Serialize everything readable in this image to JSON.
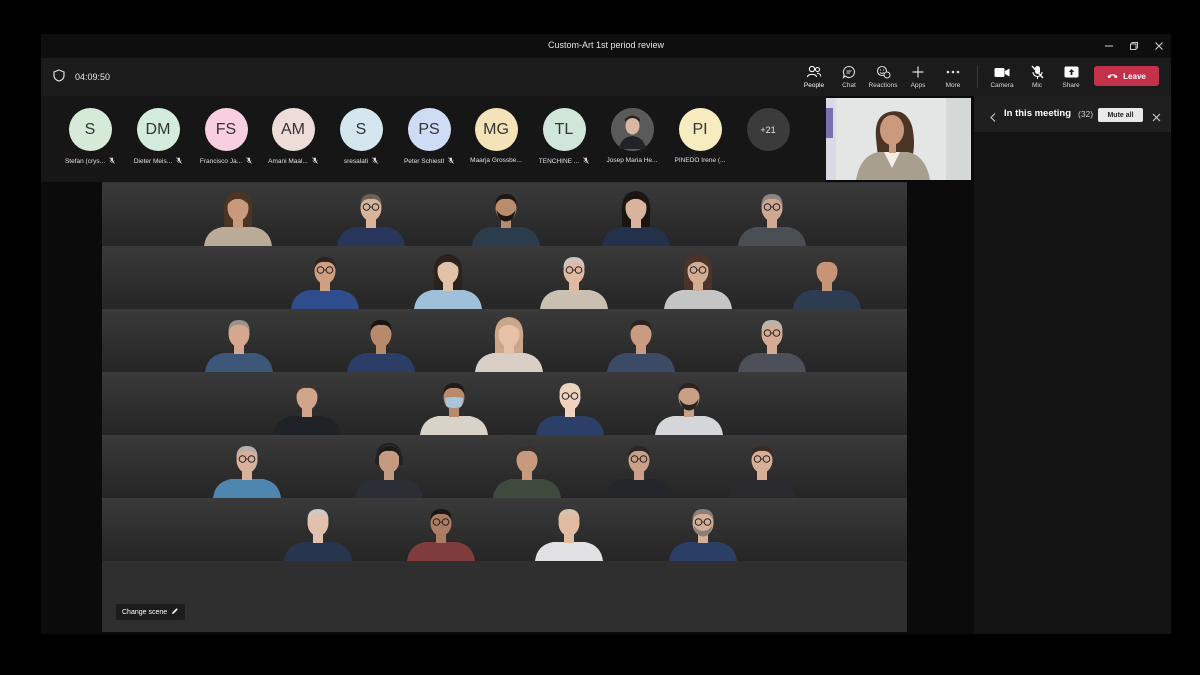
{
  "window": {
    "title": "Custom-Art 1st period review",
    "controls": [
      "minimize",
      "restore",
      "close"
    ]
  },
  "toolbar": {
    "timer": "04:09:50",
    "buttons": [
      {
        "label": "People",
        "icon": "people-icon",
        "active": true
      },
      {
        "label": "Chat",
        "icon": "chat-icon",
        "active": false
      },
      {
        "label": "Reactions",
        "icon": "reactions-icon",
        "active": false
      },
      {
        "label": "Apps",
        "icon": "apps-icon",
        "active": false
      },
      {
        "label": "More",
        "icon": "more-icon",
        "active": false
      },
      {
        "label": "Camera",
        "icon": "camera-icon",
        "active": false
      },
      {
        "label": "Mic",
        "icon": "mic-muted-icon",
        "active": false
      },
      {
        "label": "Share",
        "icon": "share-icon",
        "active": false
      }
    ],
    "leave_label": "Leave",
    "leave_color": "#c4314b"
  },
  "participants": [
    {
      "initials": "S",
      "name": "Stefan (crys...",
      "color": "#d6ead8",
      "muted": true
    },
    {
      "initials": "DM",
      "name": "Dieter Meis...",
      "color": "#d3ecdb",
      "muted": true
    },
    {
      "initials": "FS",
      "name": "Francisco Ja...",
      "color": "#f7cfe0",
      "muted": true
    },
    {
      "initials": "AM",
      "name": "Amani Maal...",
      "color": "#eddcd8",
      "muted": true
    },
    {
      "initials": "S",
      "name": "sresalati",
      "color": "#d4e7ef",
      "muted": true
    },
    {
      "initials": "PS",
      "name": "Peter Schiestl",
      "color": "#cfdcf5",
      "muted": true
    },
    {
      "initials": "MG",
      "name": "Maarja Grossbe...",
      "color": "#f4e3b8",
      "muted": false
    },
    {
      "initials": "TL",
      "name": "TENCHINE ...",
      "color": "#cfe6d8",
      "muted": true
    },
    {
      "initials": "",
      "name": "Josep Maria He...",
      "color": "#4a4a4a",
      "muted": false,
      "photo": true
    },
    {
      "initials": "PI",
      "name": "PINEDO Irene (...",
      "color": "#f6ecc0",
      "muted": false
    }
  ],
  "overflow_count": "+21",
  "panel": {
    "title": "In this meeting",
    "count": "(32)",
    "mute_all_label": "Mute all"
  },
  "change_scene_label": "Change scene",
  "together_mode": {
    "rows": [
      {
        "people": [
          {
            "skin": "#c9997c",
            "hair": "#4a3424",
            "shirt": "#b9ab95",
            "long_hair": true
          },
          {
            "skin": "#d8b49a",
            "hair": "#6c6257",
            "shirt": "#27365a",
            "glasses": true
          },
          {
            "skin": "#b98c6c",
            "hair": "#1d1715",
            "shirt": "#2b3d4d",
            "beard": true
          },
          {
            "skin": "#d9b39c",
            "hair": "#1a1412",
            "shirt": "#23324a",
            "long_hair": true
          },
          {
            "skin": "#cfa792",
            "hair": "#8b8683",
            "shirt": "#4a4f55",
            "glasses": true
          }
        ]
      },
      {
        "people": [
          {
            "skin": "#cf9f82",
            "hair": "#2b2320",
            "shirt": "#2f4c8c",
            "glasses": true
          },
          {
            "skin": "#e1c2a8",
            "hair": "#2c221d",
            "shirt": "#9ec0d9",
            "long_hair": true
          },
          {
            "skin": "#e0b9a3",
            "hair": "#c9c6c4",
            "shirt": "#c9c0b2",
            "glasses": true
          },
          {
            "skin": "#d3ac94",
            "hair": "#4b3427",
            "shirt": "#c5c5c5",
            "long_hair": true,
            "glasses": true
          },
          {
            "skin": "#c79478",
            "hair": "#3a3230",
            "shirt": "#2c3d52"
          }
        ]
      },
      {
        "people": [
          {
            "skin": "#d4a78e",
            "hair": "#9c948b",
            "shirt": "#3c5777"
          },
          {
            "skin": "#b88a6c",
            "hair": "#171310",
            "shirt": "#2c3e66"
          },
          {
            "skin": "#e6c1a8",
            "hair": "#cba78a",
            "shirt": "#d9cfc6",
            "long_hair": true
          },
          {
            "skin": "#c99b81",
            "hair": "#2a2320",
            "shirt": "#3b4b66"
          },
          {
            "skin": "#d5ab93",
            "hair": "#b9b4ae",
            "shirt": "#4c5159",
            "glasses": true
          }
        ]
      },
      {
        "people": [
          {
            "skin": "#d1a58c",
            "hair": "#3d3530",
            "shirt": "#1f2226"
          },
          {
            "skin": "#b98a6c",
            "hair": "#1d1a18",
            "shirt": "#d8d2c8",
            "mask": true
          },
          {
            "skin": "#efd3c0",
            "hair": "#e4d6bf",
            "shirt": "#2c3f66",
            "glasses": true
          },
          {
            "skin": "#c99f86",
            "hair": "#2b2422",
            "shirt": "#d5d6da",
            "beard": true
          }
        ]
      },
      {
        "people": [
          {
            "skin": "#d9b09b",
            "hair": "#b7b0aa",
            "shirt": "#4f86b0",
            "glasses": true
          },
          {
            "skin": "#c49b80",
            "hair": "#1e1a18",
            "shirt": "#2b2f35",
            "headphones": true
          },
          {
            "skin": "#c79a80",
            "hair": "#3a2f2a",
            "shirt": "#3f4a3f"
          },
          {
            "skin": "#caa088",
            "hair": "#2a2624",
            "shirt": "#23262b",
            "glasses": true
          },
          {
            "skin": "#d7af98",
            "hair": "#3a2a22",
            "shirt": "#2a2a2e",
            "glasses": true
          }
        ]
      },
      {
        "people": [
          {
            "skin": "#e1c0ad",
            "hair": "#cfcac5",
            "shirt": "#28354f"
          },
          {
            "skin": "#ac7d62",
            "hair": "#1a1614",
            "shirt": "#7e3c3c",
            "glasses": true
          },
          {
            "skin": "#e2bba3",
            "hair": "#d7c3ad",
            "shirt": "#e1e1e3"
          },
          {
            "skin": "#d5ae96",
            "hair": "#8a8078",
            "shirt": "#2b3e66",
            "glasses": true,
            "beard": true
          }
        ]
      }
    ]
  }
}
